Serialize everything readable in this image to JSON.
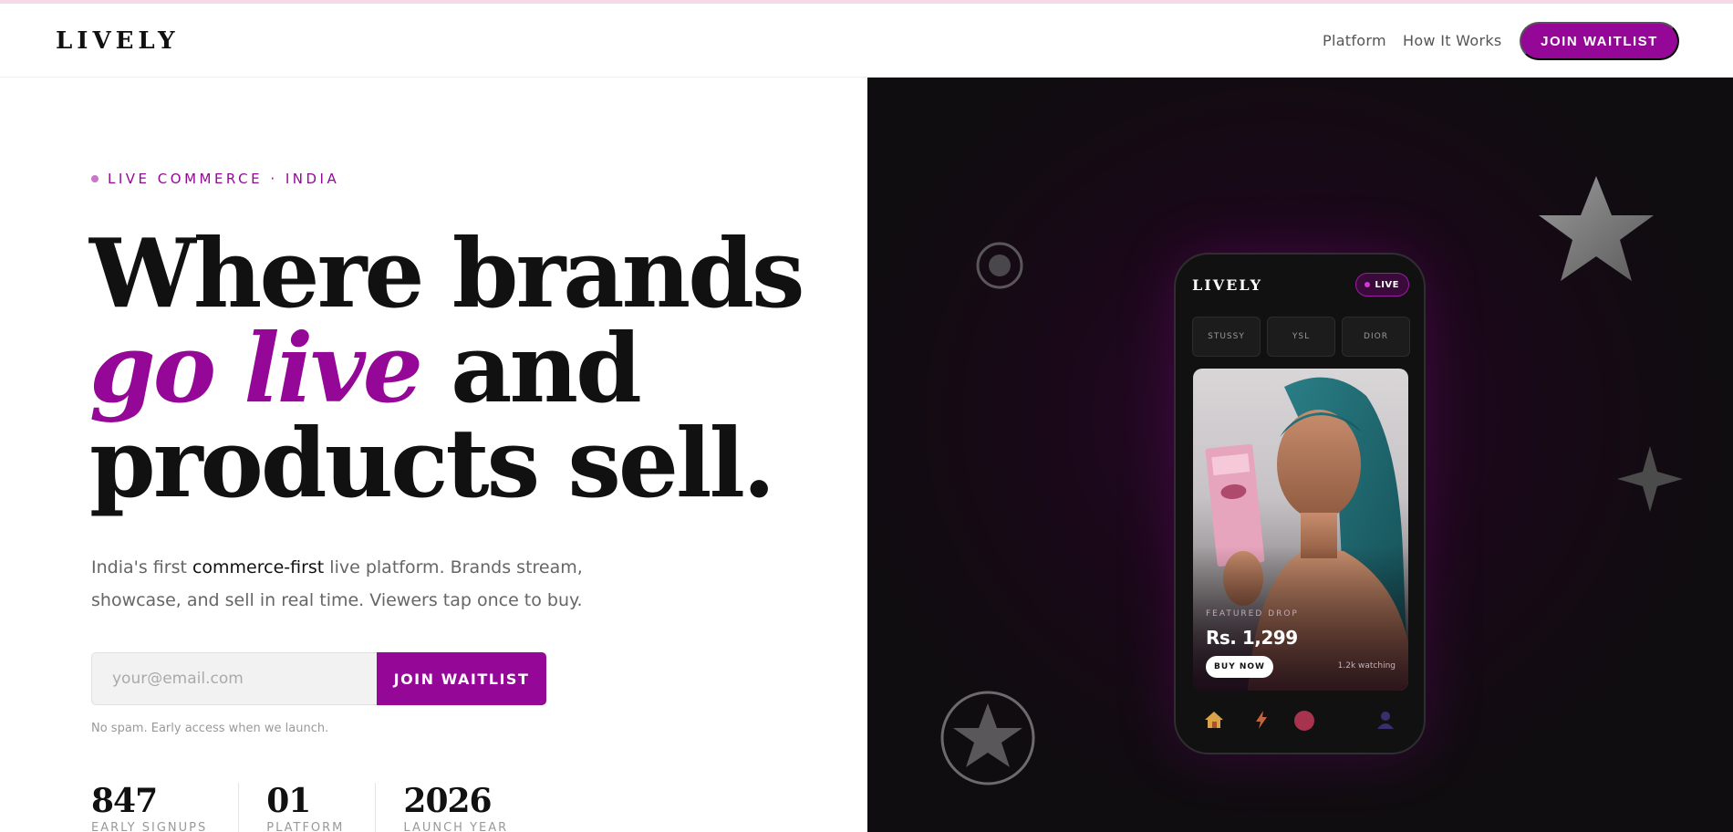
{
  "header": {
    "logo": "LIVELY",
    "nav": [
      "Platform",
      "How It Works"
    ],
    "cta": "JOIN WAITLIST"
  },
  "hero": {
    "eyebrow": "LIVE COMMERCE · INDIA",
    "headline": {
      "line1": "Where brands",
      "line2_accent": "go live",
      "line2_rest": " and",
      "line3": "products sell."
    },
    "sub_before": "India's first ",
    "sub_highlight": "commerce-first",
    "sub_after": " live platform. Brands stream, showcase, and sell in real time. Viewers tap once to buy.",
    "email_placeholder": "your@email.com",
    "cta": "JOIN WAITLIST",
    "note": "No spam. Early access when we launch."
  },
  "stats": [
    {
      "value": "847",
      "label": "EARLY SIGNUPS"
    },
    {
      "value": "01",
      "label": "PLATFORM"
    },
    {
      "value": "2026",
      "label": "LAUNCH YEAR"
    }
  ],
  "phone": {
    "logo": "LIVELY",
    "live_label": "LIVE",
    "brands": [
      "STUSSY",
      "YSL",
      "DIOR"
    ],
    "featured_label": "FEATURED DROP",
    "price": "Rs. 1,299",
    "buy": "BUY NOW",
    "watching": "1.2k watching",
    "nav_icons": [
      "home-icon",
      "bolt-icon",
      "record-icon",
      "profile-icon"
    ]
  },
  "colors": {
    "accent": "#950797",
    "panel": "#0f0d0f"
  }
}
